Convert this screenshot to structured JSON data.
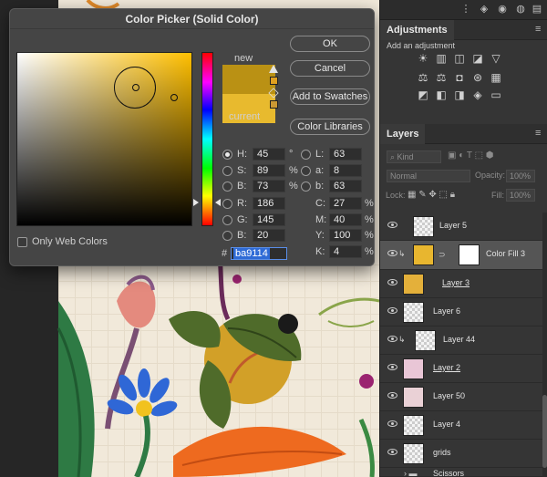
{
  "dialog": {
    "title": "Color Picker (Solid Color)",
    "new_label": "new",
    "current_label": "current",
    "new_color": "#ba9114",
    "current_color": "#e8ba2e",
    "buttons": {
      "ok": "OK",
      "cancel": "Cancel",
      "add_to_swatches": "Add to Swatches",
      "color_libraries": "Color Libraries"
    },
    "only_web_colors": "Only Web Colors",
    "fields": {
      "H": {
        "label": "H:",
        "value": "45",
        "unit": "°"
      },
      "S": {
        "label": "S:",
        "value": "89",
        "unit": "%"
      },
      "B": {
        "label": "B:",
        "value": "73",
        "unit": "%"
      },
      "R": {
        "label": "R:",
        "value": "186"
      },
      "G": {
        "label": "G:",
        "value": "145"
      },
      "Bl": {
        "label": "B:",
        "value": "20"
      },
      "L": {
        "label": "L:",
        "value": "63"
      },
      "a": {
        "label": "a:",
        "value": "8"
      },
      "b": {
        "label": "b:",
        "value": "63"
      },
      "C": {
        "label": "C:",
        "value": "27",
        "unit": "%"
      },
      "M": {
        "label": "M:",
        "value": "40",
        "unit": "%"
      },
      "Y": {
        "label": "Y:",
        "value": "100",
        "unit": "%"
      },
      "K": {
        "label": "K:",
        "value": "4",
        "unit": "%"
      }
    },
    "hex_label": "#",
    "hex_value": "ba9114"
  },
  "adjustments": {
    "tab": "Adjustments",
    "subtitle": "Add an adjustment",
    "icons_row1": [
      "brightness-icon",
      "levels-icon",
      "curves-icon",
      "exposure-icon",
      "triangle-icon"
    ],
    "icons_row2": [
      "balance-icon",
      "color-balance-icon",
      "camera-icon",
      "channel-mixer-icon",
      "lookup-grid-icon"
    ],
    "icons_row3": [
      "invert-icon",
      "posterize-icon",
      "threshold-icon",
      "selective-color-icon",
      "gradient-map-icon"
    ]
  },
  "layers": {
    "tab": "Layers",
    "kind_label": "Kind",
    "blend_mode": "Normal",
    "opacity_label": "Opacity:",
    "opacity_value": "100%",
    "lock_label": "Lock:",
    "fill_label": "Fill:",
    "fill_value": "100%",
    "rows": [
      {
        "name": "Layer 5",
        "underline": false,
        "selected": false
      },
      {
        "name": "Color Fill 3",
        "underline": false,
        "selected": true
      },
      {
        "name": "Layer 3",
        "underline": true,
        "selected": false
      },
      {
        "name": "Layer 6",
        "underline": false,
        "selected": false
      },
      {
        "name": "Layer 44",
        "underline": false,
        "selected": false
      },
      {
        "name": "Layer 2",
        "underline": true,
        "selected": false
      },
      {
        "name": "Layer 50",
        "underline": false,
        "selected": false
      },
      {
        "name": "Layer 4",
        "underline": false,
        "selected": false
      },
      {
        "name": "grids",
        "underline": false,
        "selected": false
      },
      {
        "name": "Scissors",
        "underline": false,
        "selected": false
      }
    ]
  },
  "colors": {
    "accent": "#2f6bd6",
    "fill_swatch": "#e8b62f"
  }
}
